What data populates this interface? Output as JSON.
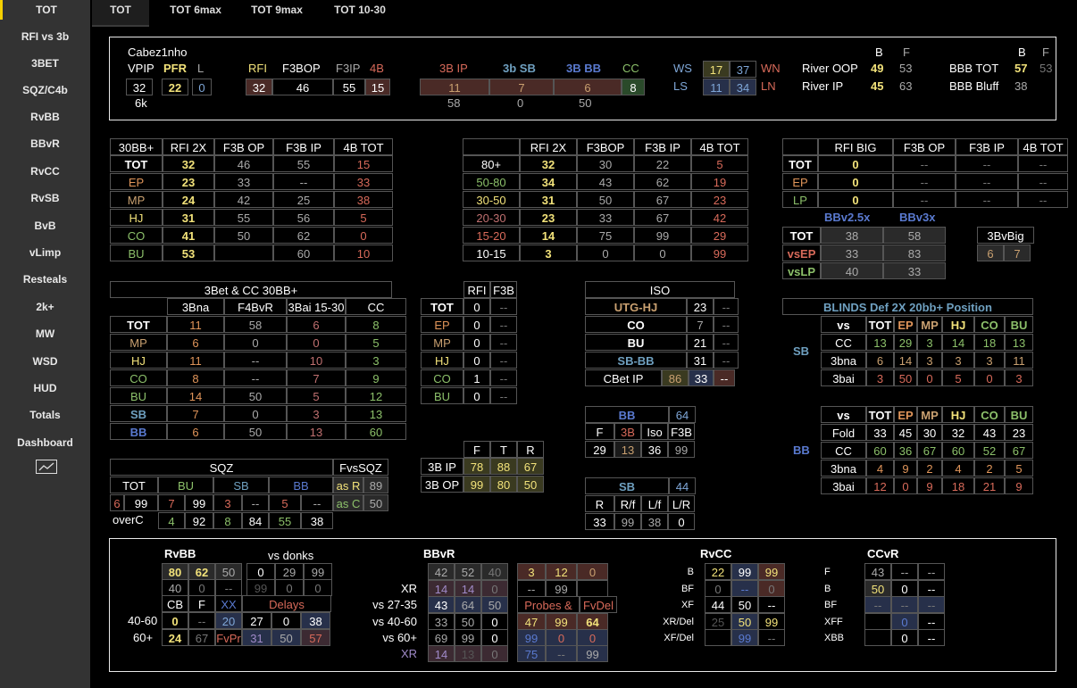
{
  "sidebar": {
    "items": [
      "TOT",
      "RFI vs 3b",
      "3BET",
      "SQZ/C4b",
      "RvBB",
      "BBvR",
      "RvCC",
      "RvSB",
      "BvB",
      "vLimp",
      "Resteals",
      "2k+",
      "MW",
      "WSD",
      "HUD",
      "Totals",
      "Dashboard"
    ],
    "chart_icon": "chart-icon"
  },
  "tabs": [
    "TOT",
    "TOT 6max",
    "TOT 9max",
    "TOT 10-30"
  ],
  "header": {
    "player": "Cabez1nho",
    "hands": "6k",
    "vpip_label": "VPIP",
    "pfr_label": "PFR",
    "l_label": "L",
    "vpip": "32",
    "pfr": "22",
    "l": "0",
    "rfi_label": "RFI",
    "f3bop_label": "F3BOP",
    "f3ip_label": "F3IP",
    "fb4_label": "4B",
    "rfi": "32",
    "f3bop": "46",
    "f3ip": "55",
    "fb4": "15",
    "ip3b_label": "3B IP",
    "sb3b_label": "3b SB",
    "bb3b_label": "3B BB",
    "cc_label": "CC",
    "ip3b": "11",
    "sb3b": "7",
    "bb3b": "6",
    "cc": "8",
    "ip3b_sub": "58",
    "sb3b_sub": "0",
    "bb3b_sub": "50",
    "ws_label": "WS",
    "ws": "17",
    "wsn": "37",
    "wn_label": "WN",
    "ls_label": "LS",
    "ls": "11",
    "lsn": "34",
    "ln_label": "LN",
    "b_label": "B",
    "f_label": "F",
    "river_oop_label": "River OOP",
    "river_oop_b": "49",
    "river_oop_f": "53",
    "river_ip_label": "River IP",
    "river_ip_b": "45",
    "river_ip_f": "63",
    "b2_label": "B",
    "f2_label": "F",
    "bbb_tot_label": "BBB TOT",
    "bbb_tot_b": "57",
    "bbb_tot_f": "53",
    "bbb_bluff_label": "BBB Bluff",
    "bbb_bluff_b": "38"
  },
  "t1": {
    "headers": [
      "30BB+",
      "RFI 2X",
      "F3B OP",
      "F3B IP",
      "4B TOT"
    ],
    "rows": [
      [
        "TOT",
        "32",
        "46",
        "55",
        "15"
      ],
      [
        "EP",
        "23",
        "33",
        "--",
        "33"
      ],
      [
        "MP",
        "24",
        "42",
        "25",
        "38"
      ],
      [
        "HJ",
        "31",
        "55",
        "56",
        "5"
      ],
      [
        "CO",
        "41",
        "50",
        "62",
        "0"
      ],
      [
        "BU",
        "53",
        "",
        "60",
        "10"
      ]
    ]
  },
  "t2": {
    "headers": [
      "",
      "RFI 2X",
      "F3BOP",
      "F3B IP",
      "4B TOT"
    ],
    "rows": [
      [
        "80+",
        "32",
        "30",
        "22",
        "5"
      ],
      [
        "50-80",
        "34",
        "43",
        "62",
        "19"
      ],
      [
        "30-50",
        "31",
        "50",
        "67",
        "23"
      ],
      [
        "20-30",
        "23",
        "33",
        "67",
        "42"
      ],
      [
        "15-20",
        "14",
        "75",
        "99",
        "29"
      ],
      [
        "10-15",
        "3",
        "0",
        "0",
        "99"
      ]
    ]
  },
  "t3": {
    "headers": [
      "",
      "RFI BIG",
      "F3B OP",
      "F3B IP",
      "4B TOT"
    ],
    "rows": [
      [
        "TOT",
        "0",
        "--",
        "--",
        "--"
      ],
      [
        "EP",
        "0",
        "--",
        "--",
        "--"
      ],
      [
        "LP",
        "0",
        "--",
        "--",
        "--"
      ]
    ],
    "bb_headers": [
      "BBv2.5x",
      "BBv3x"
    ],
    "bb_rows": [
      [
        "TOT",
        "38",
        "58"
      ],
      [
        "vsEP",
        "33",
        "83"
      ],
      [
        "vsLP",
        "40",
        "33"
      ]
    ],
    "bvbig_label": "3BvBig",
    "bvbig": [
      "6",
      "7"
    ]
  },
  "t4": {
    "title": "3Bet & CC 30BB+",
    "headers": [
      "3Bna",
      "F4BvR",
      "3Bai 15-30",
      "CC"
    ],
    "rows": [
      [
        "TOT",
        "11",
        "58",
        "6",
        "8"
      ],
      [
        "MP",
        "6",
        "0",
        "0",
        "5"
      ],
      [
        "HJ",
        "11",
        "--",
        "10",
        "3"
      ],
      [
        "CO",
        "8",
        "--",
        "7",
        "9"
      ],
      [
        "BU",
        "14",
        "50",
        "5",
        "12"
      ],
      [
        "SB",
        "7",
        "0",
        "3",
        "13"
      ],
      [
        "BB",
        "6",
        "50",
        "13",
        "60"
      ]
    ]
  },
  "t5": {
    "headers": [
      "RFI",
      "F3B"
    ],
    "rows": [
      [
        "TOT",
        "0",
        "--"
      ],
      [
        "EP",
        "0",
        "--"
      ],
      [
        "MP",
        "0",
        "--"
      ],
      [
        "HJ",
        "0",
        "--"
      ],
      [
        "CO",
        "1",
        "--"
      ],
      [
        "BU",
        "0",
        "--"
      ]
    ]
  },
  "t6": {
    "title": "ISO",
    "rows": [
      [
        "UTG-HJ",
        "23",
        "--"
      ],
      [
        "CO",
        "7",
        "--"
      ],
      [
        "BU",
        "21",
        "--"
      ],
      [
        "SB-BB",
        "31",
        "--"
      ]
    ],
    "cbet_label": "CBet IP",
    "cbet": [
      "86",
      "33",
      "--"
    ]
  },
  "t7": {
    "headers": [
      "F",
      "T",
      "R"
    ],
    "rows": [
      [
        "3B IP",
        "78",
        "88",
        "67"
      ],
      [
        "3B OP",
        "99",
        "80",
        "50"
      ]
    ]
  },
  "t8": {
    "bb_label": "BB",
    "bb_n": "64",
    "headers": [
      "F",
      "3B",
      "Iso",
      "F3B"
    ],
    "vals": [
      "29",
      "13",
      "36",
      "99"
    ],
    "sb_label": "SB",
    "sb_n": "44",
    "sb_headers": [
      "R",
      "R/f",
      "L/f",
      "L/R"
    ],
    "sb_vals": [
      "33",
      "99",
      "38",
      "0"
    ]
  },
  "t9": {
    "title": "SQZ",
    "fvs_label": "FvsSQZ",
    "tot_label": "TOT",
    "bu_label": "BU",
    "sb_label": "SB",
    "bb_label": "BB",
    "row1": [
      "6",
      "99",
      "7",
      "99",
      "3",
      "--",
      "5",
      "--"
    ],
    "asr_label": "as R",
    "asr": "89",
    "asc_label": "as C",
    "asc": "50",
    "overc_label": "overC",
    "overc": [
      "4",
      "92",
      "8",
      "84",
      "55",
      "38"
    ]
  },
  "blinds": {
    "title": "BLINDS  Def  2X  20bb+  Position",
    "headers": [
      "vs",
      "TOT",
      "EP",
      "MP",
      "HJ",
      "CO",
      "BU"
    ],
    "sb_label": "SB",
    "sb_rows": [
      [
        "CC",
        "13",
        "29",
        "3",
        "14",
        "18",
        "13"
      ],
      [
        "3bna",
        "6",
        "14",
        "3",
        "3",
        "3",
        "11"
      ],
      [
        "3bai",
        "3",
        "50",
        "0",
        "5",
        "0",
        "3"
      ]
    ],
    "bb_label": "BB",
    "bb_rows": [
      [
        "Fold",
        "33",
        "45",
        "30",
        "32",
        "43",
        "23"
      ],
      [
        "CC",
        "60",
        "36",
        "67",
        "60",
        "52",
        "67"
      ],
      [
        "3bna",
        "4",
        "9",
        "2",
        "4",
        "2",
        "5"
      ],
      [
        "3bai",
        "12",
        "0",
        "9",
        "18",
        "21",
        "9"
      ]
    ]
  },
  "bottom": {
    "rvbb": {
      "title": "RvBB",
      "vs_donks": "vs donks",
      "r1": [
        "80",
        "62",
        "50"
      ],
      "r1b": [
        "0",
        "29",
        "99"
      ],
      "r2": [
        "40",
        "0",
        "--"
      ],
      "r2b": [
        "99",
        "0",
        "0"
      ],
      "h3": [
        "CB",
        "F",
        "XX"
      ],
      "delays": "Delays",
      "l4": "40-60",
      "r4": [
        "0",
        "--",
        "20"
      ],
      "r4b": [
        "27",
        "0",
        "38"
      ],
      "l5": "60+",
      "r5": [
        "24",
        "67"
      ],
      "fvpr": "FvPr",
      "r5b": [
        "31",
        "50",
        "57"
      ]
    },
    "bbvr": {
      "title": "BBvR",
      "l": [
        "",
        "XR",
        "vs 27-35",
        "vs 40-60",
        "vs 60+",
        "XR"
      ],
      "r1": [
        "42",
        "52",
        "40"
      ],
      "r1b": [
        "3",
        "12",
        "0"
      ],
      "r2": [
        "14",
        "14",
        "0"
      ],
      "r2b": [
        "--",
        "99",
        ""
      ],
      "r3": [
        "43",
        "64",
        "50"
      ],
      "probes": "Probes &",
      "fvdel": "FvDel",
      "r4": [
        "33",
        "50",
        "0"
      ],
      "r4b": [
        "47",
        "99",
        "64"
      ],
      "r5": [
        "69",
        "99",
        "0"
      ],
      "r5b": [
        "99",
        "0",
        "0"
      ],
      "r6": [
        "14",
        "13",
        "0"
      ],
      "r6b": [
        "75",
        "--",
        "99"
      ]
    },
    "rvcc": {
      "title": "RvCC",
      "l": [
        "B",
        "BF",
        "XF",
        "XR/Del",
        "XF/Del"
      ],
      "r1": [
        "22",
        "99",
        "99"
      ],
      "r2": [
        "0",
        "--",
        "0"
      ],
      "r3": [
        "44",
        "50",
        "--"
      ],
      "r4": [
        "25",
        "50",
        "99"
      ],
      "r5": [
        "",
        "99",
        "--"
      ]
    },
    "ccvr": {
      "title": "CCvR",
      "l": [
        "F",
        "B",
        "BF",
        "XFF",
        "XBB"
      ],
      "r1": [
        "43",
        "--",
        "--"
      ],
      "r2": [
        "50",
        "0",
        "--"
      ],
      "r3": [
        "--",
        "--",
        "--"
      ],
      "r4": [
        "",
        "0",
        "--"
      ],
      "r5": [
        "",
        "0",
        "--"
      ]
    }
  }
}
